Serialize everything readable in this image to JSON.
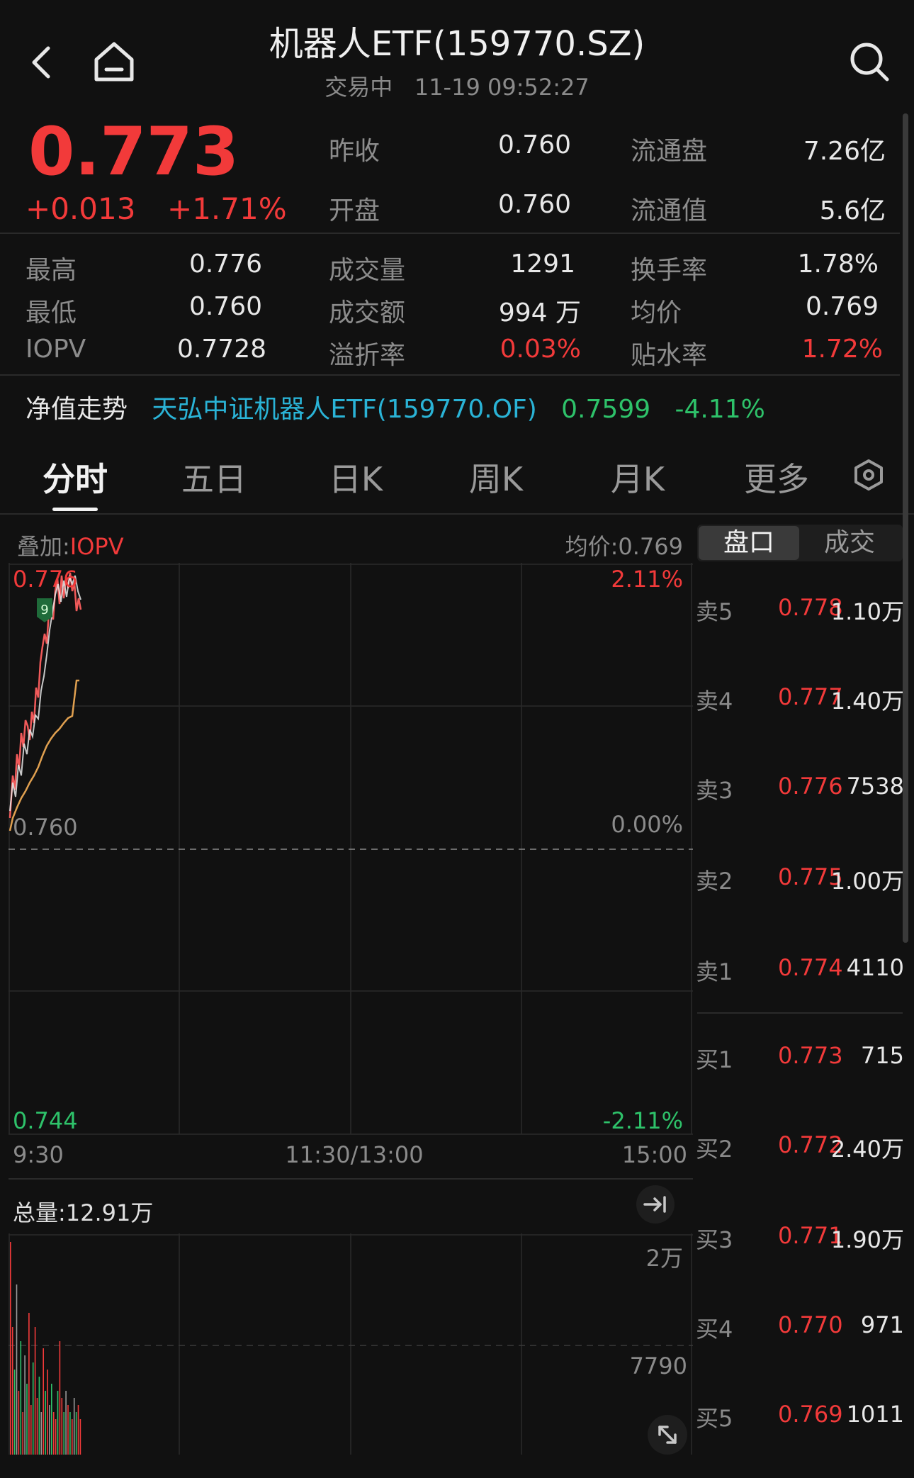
{
  "header": {
    "title": "机器人ETF(159770.SZ)",
    "status": "交易中",
    "datetime": "11-19 09:52:27"
  },
  "quote": {
    "price": "0.773",
    "change": "+0.013",
    "change_pct": "+1.71%",
    "prev_close_label": "昨收",
    "prev_close": "0.760",
    "open_label": "开盘",
    "open": "0.760",
    "float_shares_label": "流通盘",
    "float_shares": "7.26亿",
    "float_value_label": "流通值",
    "float_value": "5.6亿",
    "high_label": "最高",
    "high": "0.776",
    "low_label": "最低",
    "low": "0.760",
    "iopv_label": "IOPV",
    "iopv": "0.7728",
    "volume_label": "成交量",
    "volume": "1291",
    "amount_label": "成交额",
    "amount": "994 万",
    "premium_label": "溢折率",
    "premium": "0.03%",
    "turnover_label": "换手率",
    "turnover": "1.78%",
    "avg_label": "均价",
    "avg": "0.769",
    "discount_label": "贴水率",
    "discount": "1.72%"
  },
  "nav": {
    "label": "净值走势",
    "fund": "天弘中证机器人ETF(159770.OF)",
    "value": "0.7599",
    "change": "-4.11%"
  },
  "tabs": [
    "分时",
    "五日",
    "日K",
    "周K",
    "月K",
    "更多"
  ],
  "chart": {
    "overlay_label": "叠加:",
    "overlay_value": "IOPV",
    "avg_price": "均价:0.769",
    "y_top": "0.776",
    "y_mid": "0.760",
    "y_bot": "0.744",
    "pct_top": "2.11%",
    "pct_mid": "0.00%",
    "pct_bot": "-2.11%",
    "x_start": "9:30",
    "x_mid": "11:30/13:00",
    "x_end": "15:00",
    "total_volume": "总量:12.91万",
    "vol_top": "2万",
    "vol_mid": "7790",
    "badge": "9"
  },
  "book": {
    "tab_active": "盘口",
    "tab_other": "成交",
    "asks": [
      {
        "label": "卖5",
        "price": "0.778",
        "vol": "1.10万"
      },
      {
        "label": "卖4",
        "price": "0.777",
        "vol": "1.40万"
      },
      {
        "label": "卖3",
        "price": "0.776",
        "vol": "7538"
      },
      {
        "label": "卖2",
        "price": "0.775",
        "vol": "1.00万"
      },
      {
        "label": "卖1",
        "price": "0.774",
        "vol": "4110"
      }
    ],
    "bids": [
      {
        "label": "买1",
        "price": "0.773",
        "vol": "715"
      },
      {
        "label": "买2",
        "price": "0.772",
        "vol": "2.40万"
      },
      {
        "label": "买3",
        "price": "0.771",
        "vol": "1.90万"
      },
      {
        "label": "买4",
        "price": "0.770",
        "vol": "971"
      },
      {
        "label": "买5",
        "price": "0.769",
        "vol": "1011"
      }
    ]
  },
  "colors": {
    "up": "#f23a3a",
    "down": "#2ec26a",
    "accent": "#2ab3d6",
    "avg_line": "#e0a050"
  }
}
